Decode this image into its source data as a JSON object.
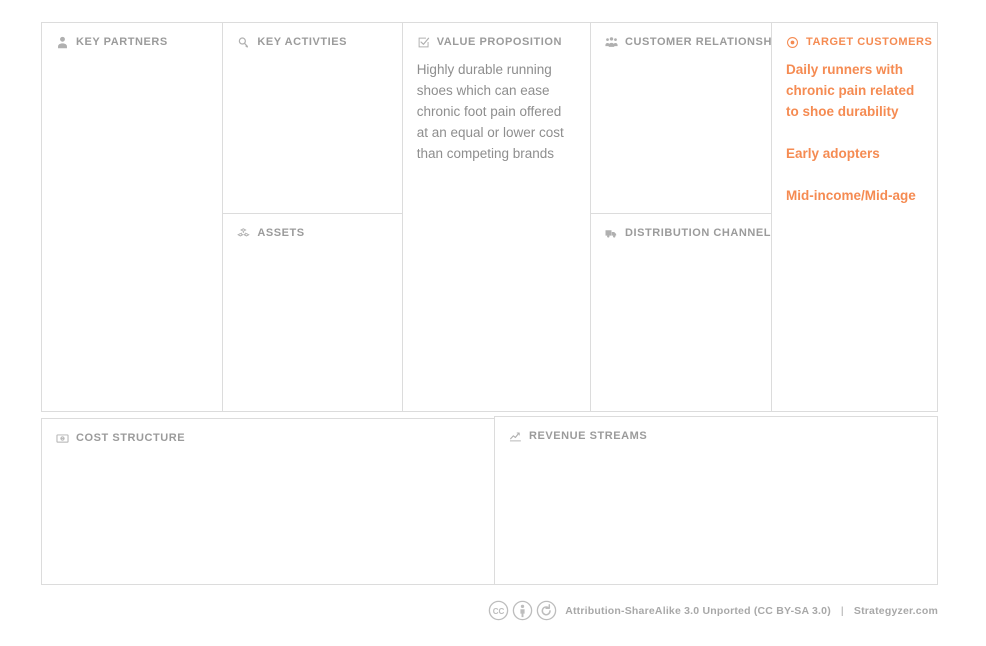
{
  "canvas": {
    "accent_color": "#f58b52",
    "label_color": "#9b9b9b",
    "border_color": "#dcdcdc",
    "background_color": "#ffffff",
    "blocks": {
      "key_partners": {
        "title": "KEY PARTNERS",
        "icon": "person-icon",
        "content": ""
      },
      "key_activities": {
        "title": "KEY ACTIVTIES",
        "icon": "magnifier-icon",
        "content": ""
      },
      "assets": {
        "title": "ASSETS",
        "icon": "cubes-icon",
        "content": ""
      },
      "value_proposition": {
        "title": "VALUE PROPOSITION",
        "icon": "checked-box-icon",
        "content": "Highly durable running shoes which can ease chronic foot pain offered at an equal or lower cost than competing brands"
      },
      "customer_relationships": {
        "title": "CUSTOMER RELATIONSHIPS",
        "icon": "people-group-icon",
        "content": ""
      },
      "distribution_channels": {
        "title": "DISTRIBUTION CHANNELS",
        "icon": "truck-icon",
        "content": ""
      },
      "target_customers": {
        "title": "TARGET CUSTOMERS",
        "icon": "bullseye-icon",
        "notes": [
          "Daily runners with chronic pain related to shoe durability",
          "Early adopters",
          "Mid-income/Mid-age"
        ]
      },
      "cost_structure": {
        "title": "COST STRUCTURE",
        "icon": "money-note-icon",
        "content": ""
      },
      "revenue_streams": {
        "title": "REVENUE STREAMS",
        "icon": "line-chart-icon",
        "content": ""
      }
    }
  },
  "footer": {
    "badges": [
      "cc-icon",
      "by-person-icon",
      "share-alike-icon"
    ],
    "license_text": "Attribution-ShareAlike 3.0 Unported (CC BY-SA 3.0)",
    "separator": "|",
    "brand": "Strategyzer.com"
  }
}
